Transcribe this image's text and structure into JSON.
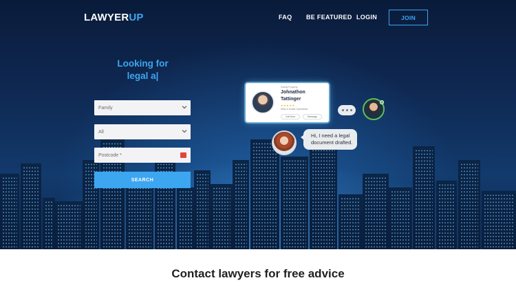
{
  "header": {
    "logo_main": "LAWYER",
    "logo_accent": "UP",
    "nav": [
      "FAQ",
      "BE FEATURED",
      "LOGIN"
    ],
    "join_label": "JOIN"
  },
  "hero": {
    "headline_line1": "Looking for",
    "headline_line2": "legal a|"
  },
  "search_form": {
    "practice_area_value": "Family",
    "filter_value": "All",
    "postcode_placeholder": "Postcode *",
    "search_label": "SEARCH"
  },
  "profile_card": {
    "tag": "Family Property",
    "name_line1": "Johnathon",
    "name_line2": "Tattinger",
    "stars": "★★★★★",
    "specialty": "Wills & Estate Specialists",
    "call_label": "Call Now",
    "message_label": "Message"
  },
  "chat": {
    "message_line1": "Hi, I need a legal",
    "message_line2": "document drafted."
  },
  "section": {
    "title": "Contact lawyers for free advice"
  },
  "colors": {
    "accent": "#3da6f0",
    "hero_dark": "#0a1b3a",
    "online": "#5ac25a"
  }
}
